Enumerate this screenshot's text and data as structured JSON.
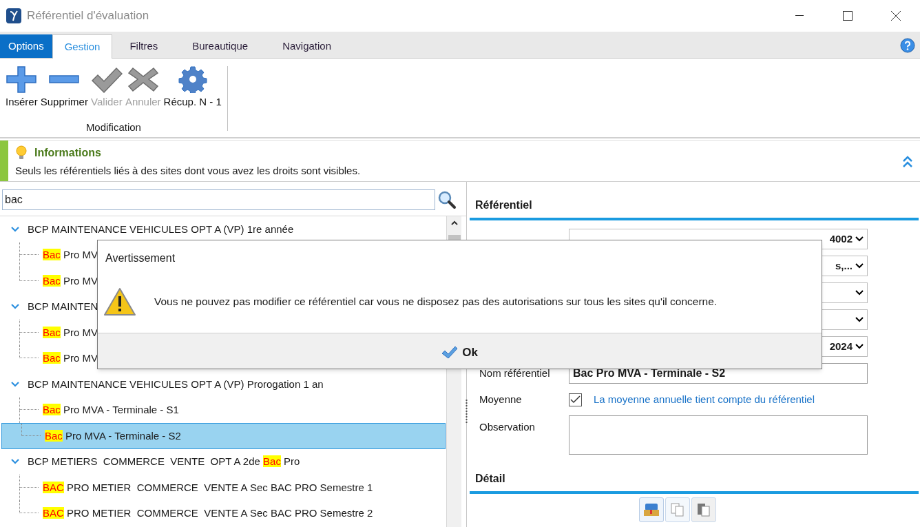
{
  "window": {
    "title": "Référentiel d'évaluation"
  },
  "ribbon": {
    "tabs": [
      {
        "label": "Options",
        "kind": "menu",
        "selected": false
      },
      {
        "label": "Gestion",
        "kind": "tab",
        "selected": true
      },
      {
        "label": "Filtres",
        "kind": "tab",
        "selected": false
      },
      {
        "label": "Bureautique",
        "kind": "tab",
        "selected": false
      },
      {
        "label": "Navigation",
        "kind": "tab",
        "selected": false
      }
    ],
    "buttons": [
      {
        "label": "Insérer",
        "disabled": false
      },
      {
        "label": "Supprimer",
        "disabled": false
      },
      {
        "label": "Valider",
        "disabled": true
      },
      {
        "label": "Annuler",
        "disabled": true
      },
      {
        "label": "Récup. N - 1",
        "disabled": false
      }
    ],
    "group_label": "Modification"
  },
  "info": {
    "title": "Informations",
    "text": "Seuls les référentiels liés à des sites dont vous avez les droits sont visibles."
  },
  "search": {
    "value": "bac"
  },
  "tree": [
    {
      "parts": [
        {
          "text": "BCP MAINTENANCE VEHICULES OPT A (VP) 1re année",
          "highlighted": false
        }
      ],
      "expanded": true,
      "selected": false,
      "children": [
        {
          "parts": [
            {
              "text": "Bac",
              "highlighted": true
            },
            {
              "text": " Pro MV",
              "highlighted": false
            }
          ],
          "selected": false
        },
        {
          "parts": [
            {
              "text": "Bac",
              "highlighted": true
            },
            {
              "text": " Pro MV",
              "highlighted": false
            }
          ],
          "selected": false
        }
      ]
    },
    {
      "parts": [
        {
          "text": "BCP MAINTEN",
          "highlighted": false
        }
      ],
      "expanded": true,
      "selected": false,
      "children": [
        {
          "parts": [
            {
              "text": "Bac",
              "highlighted": true
            },
            {
              "text": " Pro MV",
              "highlighted": false
            }
          ],
          "selected": false
        },
        {
          "parts": [
            {
              "text": "Bac",
              "highlighted": true
            },
            {
              "text": " Pro MV",
              "highlighted": false
            }
          ],
          "selected": false
        }
      ]
    },
    {
      "parts": [
        {
          "text": "BCP MAINTENANCE VEHICULES OPT A (VP) Prorogation 1 an",
          "highlighted": false
        }
      ],
      "expanded": true,
      "selected": false,
      "children": [
        {
          "parts": [
            {
              "text": "Bac",
              "highlighted": true
            },
            {
              "text": " Pro MVA - Terminale - S1",
              "highlighted": false
            }
          ],
          "selected": false
        },
        {
          "parts": [
            {
              "text": "Bac",
              "highlighted": true
            },
            {
              "text": " Pro MVA - Terminale - S2",
              "highlighted": false
            }
          ],
          "selected": true
        }
      ]
    },
    {
      "parts": [
        {
          "text": "BCP METIERS  COMMERCE  VENTE  OPT A 2de ",
          "highlighted": false
        },
        {
          "text": "Bac",
          "highlighted": true
        },
        {
          "text": " Pro",
          "highlighted": false
        }
      ],
      "expanded": true,
      "selected": false,
      "children": [
        {
          "parts": [
            {
              "text": "BAC",
              "highlighted": true
            },
            {
              "text": " PRO METIER  COMMERCE  VENTE A Sec BAC PRO Semestre 1",
              "highlighted": false
            }
          ],
          "selected": false
        },
        {
          "parts": [
            {
              "text": "BAC",
              "highlighted": true
            },
            {
              "text": " PRO METIER  COMMERCE  VENTE A Sec BAC PRO Semestre 2",
              "highlighted": false
            }
          ],
          "selected": false
        }
      ]
    }
  ],
  "detail_panel": {
    "section_title": "Référentiel",
    "fields": [
      {
        "kind": "select",
        "value": "4002"
      },
      {
        "kind": "select",
        "value": "s,..."
      },
      {
        "kind": "select"
      },
      {
        "kind": "select"
      },
      {
        "kind": "select",
        "value": "2024"
      },
      {
        "kind": "text",
        "label": "Nom référentiel",
        "value": "Bac Pro MVA - Terminale - S2"
      },
      {
        "kind": "checkbox",
        "label": "Moyenne",
        "checked": true,
        "text": "La moyenne annuelle tient compte du référentiel"
      },
      {
        "kind": "textarea",
        "label": "Observation"
      }
    ],
    "detail_title": "Détail"
  },
  "dialog": {
    "title": "Avertissement",
    "message": "Vous ne pouvez pas modifier ce référentiel car vous ne disposez pas des autorisations sur tous les sites qu'il concerne.",
    "button": "Ok"
  }
}
